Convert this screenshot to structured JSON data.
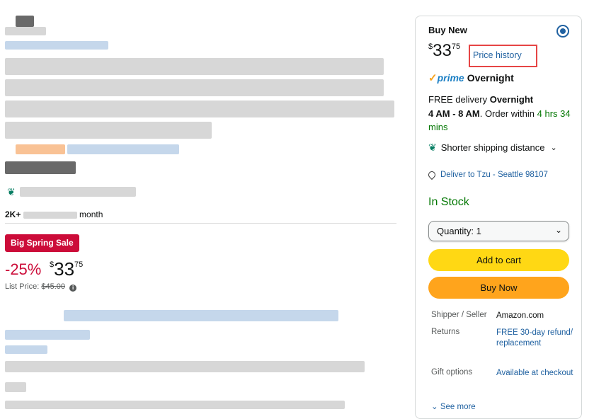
{
  "left": {
    "sold_suffix": "2K+ bought in past month",
    "sold_prefix": "2K+",
    "sold_tail": "month",
    "sale_badge": "Big Spring Sale",
    "discount": "-25%",
    "price": {
      "currency": "$",
      "whole": "33",
      "fraction": "75"
    },
    "list_price_label": "List Price:",
    "list_price_value": "$45.00"
  },
  "buybox": {
    "title": "Buy New",
    "price": {
      "currency": "$",
      "whole": "33",
      "fraction": "75"
    },
    "price_history_label": "Price history",
    "prime_label": "prime",
    "prime_shipping": "Overnight",
    "delivery_line1_prefix": "FREE delivery ",
    "delivery_line1_bold": "Overnight",
    "delivery_time": "4 AM - 8 AM",
    "delivery_order_within": ". Order within ",
    "delivery_countdown": "4 hrs 34 mins",
    "shorter_shipping": "Shorter shipping distance",
    "deliver_to": "Deliver to Tzu - Seattle 98107",
    "stock_status": "In Stock",
    "quantity_label": "Quantity:",
    "quantity_value": "1",
    "add_to_cart": "Add to cart",
    "buy_now": "Buy Now",
    "details": [
      {
        "key": "Shipper / Seller",
        "value": "Amazon.com",
        "link": false
      },
      {
        "key": "Returns",
        "value": "FREE 30-day refund/ replacement",
        "link": true
      },
      {
        "key": "Gift options",
        "value": "Available at checkout",
        "link": true
      }
    ],
    "see_more": "See more"
  },
  "colors": {
    "sale_red": "#cc0c39",
    "link_blue": "#2162a1",
    "stock_green": "#007600",
    "cart_yellow": "#ffd814",
    "buy_orange": "#ffa41c",
    "highlight_red": "#e64545"
  }
}
